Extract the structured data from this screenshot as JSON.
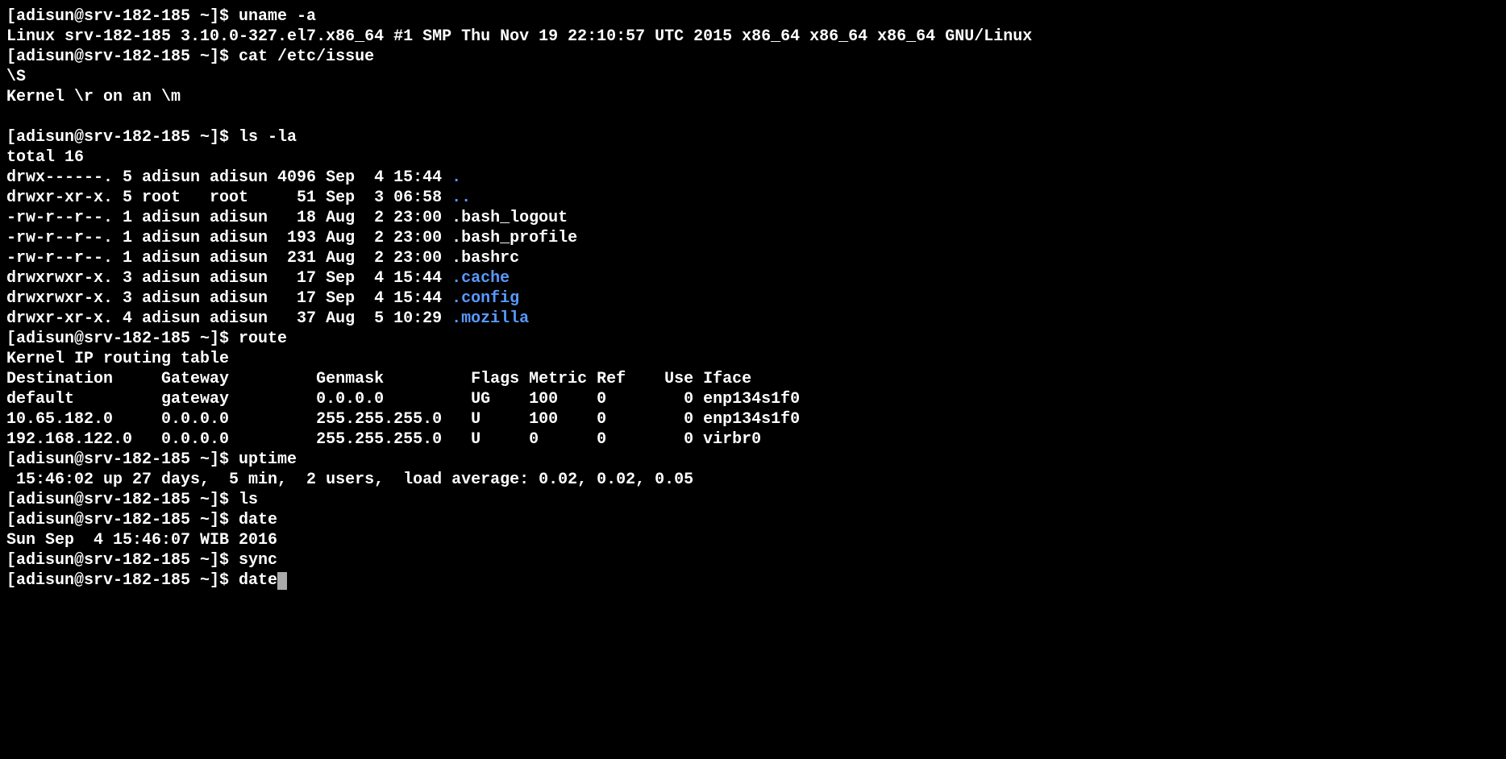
{
  "prompt": "[adisun@srv-182-185 ~]$ ",
  "colors": {
    "directory": "#5899ff"
  },
  "blocks": [
    {
      "cmd": "uname -a",
      "out": [
        "Linux srv-182-185 3.10.0-327.el7.x86_64 #1 SMP Thu Nov 19 22:10:57 UTC 2015 x86_64 x86_64 x86_64 GNU/Linux"
      ]
    },
    {
      "cmd": "cat /etc/issue",
      "out": [
        "\\S",
        "Kernel \\r on an \\m",
        ""
      ]
    },
    {
      "cmd": "ls -la",
      "out_special": "ls_la"
    },
    {
      "cmd": "route",
      "out_special": "route"
    },
    {
      "cmd": "uptime",
      "out": [
        " 15:46:02 up 27 days,  5 min,  2 users,  load average: 0.02, 0.02, 0.05"
      ]
    },
    {
      "cmd": "ls",
      "out": []
    },
    {
      "cmd": "date",
      "out": [
        "Sun Sep  4 15:46:07 WIB 2016"
      ]
    },
    {
      "cmd": "sync",
      "out": []
    }
  ],
  "ls_la": {
    "total": "total 16",
    "rows": [
      {
        "p": "drwx------. 5 adisun adisun 4096 Sep  4 15:44 ",
        "name": ".",
        "dir": true
      },
      {
        "p": "drwxr-xr-x. 5 root   root     51 Sep  3 06:58 ",
        "name": "..",
        "dir": true
      },
      {
        "p": "-rw-r--r--. 1 adisun adisun   18 Aug  2 23:00 ",
        "name": ".bash_logout",
        "dir": false
      },
      {
        "p": "-rw-r--r--. 1 adisun adisun  193 Aug  2 23:00 ",
        "name": ".bash_profile",
        "dir": false
      },
      {
        "p": "-rw-r--r--. 1 adisun adisun  231 Aug  2 23:00 ",
        "name": ".bashrc",
        "dir": false
      },
      {
        "p": "drwxrwxr-x. 3 adisun adisun   17 Sep  4 15:44 ",
        "name": ".cache",
        "dir": true
      },
      {
        "p": "drwxrwxr-x. 3 adisun adisun   17 Sep  4 15:44 ",
        "name": ".config",
        "dir": true
      },
      {
        "p": "drwxr-xr-x. 4 adisun adisun   37 Aug  5 10:29 ",
        "name": ".mozilla",
        "dir": true
      }
    ]
  },
  "route": {
    "header": "Kernel IP routing table",
    "cols": "Destination     Gateway         Genmask         Flags Metric Ref    Use Iface",
    "rows": [
      "default         gateway         0.0.0.0         UG    100    0        0 enp134s1f0",
      "10.65.182.0     0.0.0.0         255.255.255.0   U     100    0        0 enp134s1f0",
      "192.168.122.0   0.0.0.0         255.255.255.0   U     0      0        0 virbr0"
    ]
  },
  "current_input": "date"
}
